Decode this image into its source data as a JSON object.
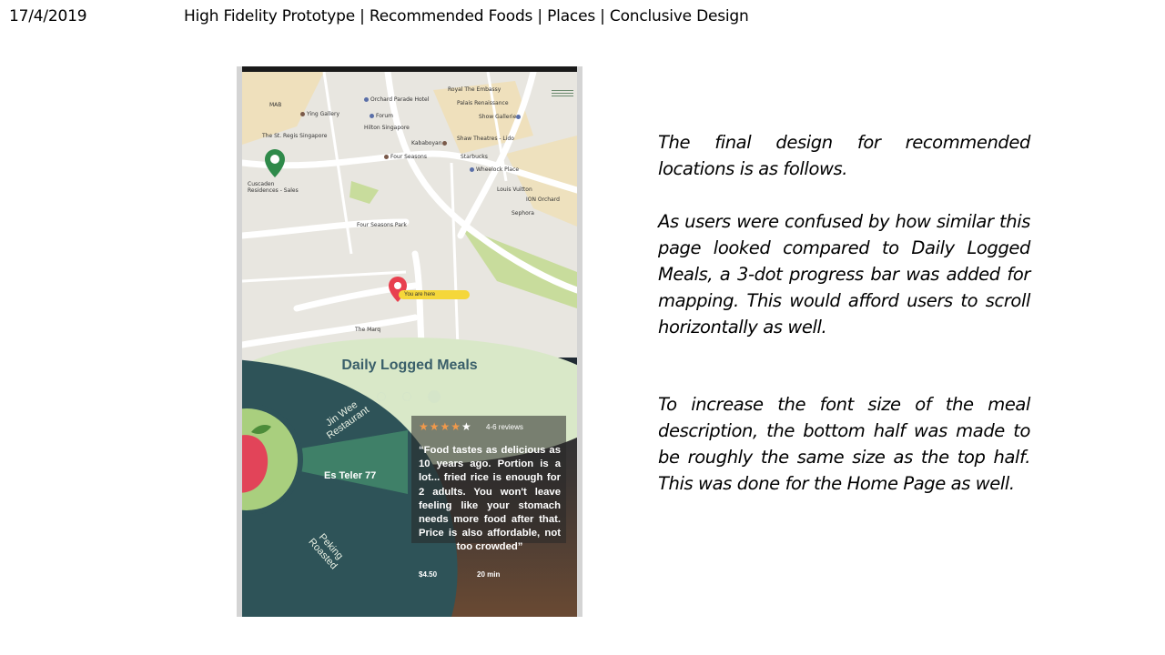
{
  "header": {
    "date": "17/4/2019",
    "title": "High Fidelity Prototype | Recommended Foods | Places | Conclusive Design"
  },
  "phone": {
    "map_labels": [
      "Royal The Embassy",
      "Orchard Parade Hotel",
      "Palais Renaissance",
      "MAB",
      "Ying Gallery",
      "Forum",
      "Show Gallerie",
      "Hilton Singapore",
      "The St. Regis Singapore",
      "Kababoyan",
      "Shaw Theatres - Lido",
      "Four Seasons",
      "Starbucks",
      "Wheelock Place",
      "Louis Vuitton",
      "ION Orchard",
      "Sephora",
      "Cuscaden Residences - Sales",
      "Four Seasons Park",
      "The Marq"
    ],
    "you_are_here": "You are here",
    "section_title": "Daily Logged Meals",
    "progress": {
      "total": 3,
      "active": 3
    },
    "wheel": {
      "items": [
        "Jin Wee Restaurant",
        "Es Teler 77",
        "Peking Roasted"
      ]
    },
    "review": {
      "stars": "★★★★",
      "star_empty": "★",
      "reviews": "4-6 reviews",
      "quote": "“Food tastes as delicious as 10 years ago. Portion is a lot... fried rice is enough for 2 adults. You won't leave feeling like your stomach needs more food after that. Price is also affordable, not too crowded”",
      "price": "$4.50",
      "time": "20 min"
    }
  },
  "description": {
    "p1": "The final design for recommended locations is as follows.",
    "p2": "As users were confused by how similar this page looked compared to Daily Logged Meals, a 3-dot progress bar was added for mapping. This would afford users to scroll horizontally as well.",
    "p3": "To increase the font size of the meal description, the bottom half was made to be roughly the same size as the top half. This was done for the Home Page as well."
  },
  "colors": {
    "map_bg": "#e8e6e0",
    "wheel_dark": "#2e5358",
    "wheel_active": "#3f8068",
    "wheel_center": "#a9cf7e",
    "accent_star": "#f2994a",
    "pin_red": "#e8404f",
    "pin_green": "#2f8a4a"
  }
}
